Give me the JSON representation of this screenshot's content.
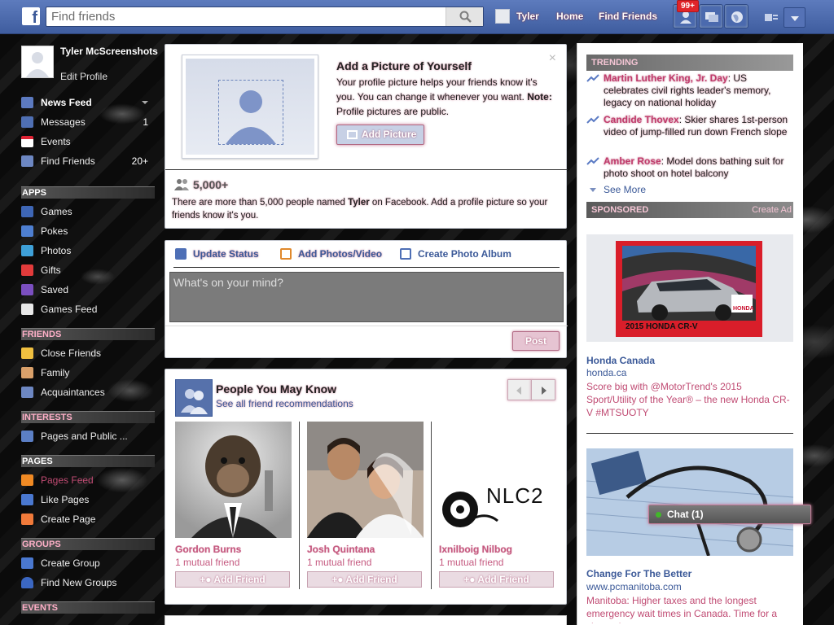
{
  "topbar": {
    "logo": "f",
    "search_placeholder": "Find friends",
    "user": "Tyler",
    "home": "Home",
    "find_friends": "Find Friends",
    "notif_badge": "99+"
  },
  "leftnav": {
    "name": "Tyler McScreenshots",
    "edit_profile": "Edit Profile",
    "favorites": [
      {
        "label": "News Feed",
        "count": ""
      },
      {
        "label": "Messages",
        "count": "1"
      },
      {
        "label": "Events",
        "count": ""
      },
      {
        "label": "Find Friends",
        "count": "20+"
      }
    ],
    "sections": {
      "apps": "APPS",
      "friends": "FRIENDS",
      "interests": "INTERESTS",
      "pages": "PAGES",
      "groups": "GROUPS",
      "events": "EVENTS"
    },
    "apps": [
      "Games",
      "Pokes",
      "Photos",
      "Gifts",
      "Saved",
      "Games Feed"
    ],
    "friends": [
      "Close Friends",
      "Family",
      "Acquaintances"
    ],
    "interests": [
      "Pages and Public ..."
    ],
    "pages": [
      "Pages Feed",
      "Like Pages",
      "Create Page"
    ],
    "groups": [
      "Create Group",
      "Find New Groups"
    ]
  },
  "add_picture": {
    "title": "Add a Picture of Yourself",
    "text": "Your profile picture helps your friends know it's you. You can change it whenever you want.",
    "note_label": "Note:",
    "note_text": " Profile pictures are public.",
    "button": "Add Picture",
    "close": "×",
    "count": "5,000+",
    "sub_pre": "There are more than 5,000 people named ",
    "sub_name": "Tyler",
    "sub_post": " on Facebook. Add a profile picture so your friends know it's you."
  },
  "composer": {
    "tabs": [
      "Update Status",
      "Add Photos/Video",
      "Create Photo Album"
    ],
    "placeholder": "What's on your mind?",
    "post": "Post"
  },
  "pymk": {
    "title": "People You May Know",
    "link": "See all friend recommendations",
    "people": [
      {
        "name": "Gordon Burns",
        "mutual": "1 mutual friend",
        "add": "Add Friend"
      },
      {
        "name": "Josh Quintana",
        "mutual": "1 mutual friend",
        "add": "Add Friend"
      },
      {
        "name": "Ixnilboig Nilbog",
        "mutual": "1 mutual friend",
        "add": "Add Friend"
      }
    ],
    "logo_text": "NLC2"
  },
  "trending": {
    "header": "TRENDING",
    "items": [
      {
        "name": "Martin Luther King, Jr. Day",
        "text": ": US celebrates civil rights leader's memory, legacy on national holiday"
      },
      {
        "name": "Candide Thovex",
        "text": ": Skier shares 1st-person video of jump-filled run down French slope"
      },
      {
        "name": "Amber Rose",
        "text": ": Model dons bathing suit for photo shoot on hotel balcony"
      }
    ],
    "see_more": "See More"
  },
  "sponsored": {
    "header": "SPONSORED",
    "create_ad": "Create Ad",
    "ads": [
      {
        "title": "Honda Canada",
        "url": "honda.ca",
        "body": "Score big with @MotorTrend's 2015 Sport/Utility of the Year® – the new Honda CR-V #MTSUOTY",
        "img_caption": "2015 HONDA CR-V",
        "brand": "HONDA"
      },
      {
        "title": "Change For The Better",
        "url": "www.pcmanitoba.com",
        "body": "Manitoba: Higher taxes and the longest emergency wait times in Canada. Time for a change!"
      }
    ]
  },
  "chat": {
    "label": "Chat (1)"
  }
}
